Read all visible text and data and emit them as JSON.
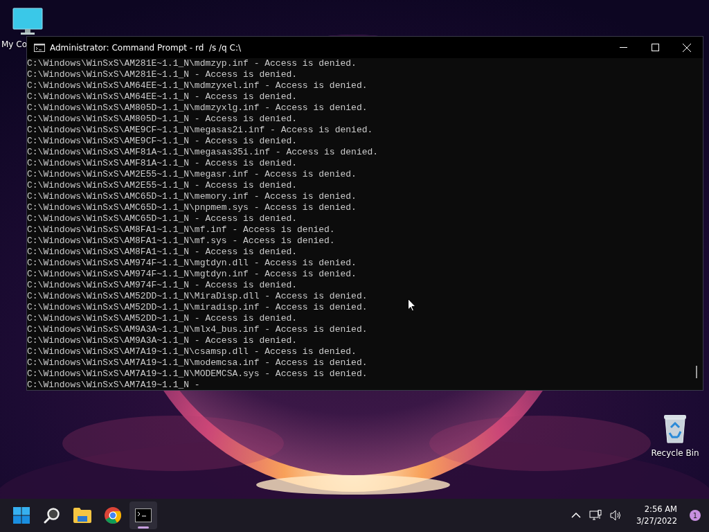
{
  "desktop_icons": [
    {
      "kind": "computer",
      "label": "My Co"
    },
    {
      "kind": "recycle",
      "label": "Recycle Bin"
    }
  ],
  "window": {
    "title": "Administrator: Command Prompt - rd  /s /q C:\\",
    "lines": [
      "C:\\Windows\\WinSxS\\AM281E~1.1_N\\mdmzyp.inf - Access is denied.",
      "C:\\Windows\\WinSxS\\AM281E~1.1_N - Access is denied.",
      "C:\\Windows\\WinSxS\\AM64EE~1.1_N\\mdmzyxel.inf - Access is denied.",
      "C:\\Windows\\WinSxS\\AM64EE~1.1_N - Access is denied.",
      "C:\\Windows\\WinSxS\\AM805D~1.1_N\\mdmzyxlg.inf - Access is denied.",
      "C:\\Windows\\WinSxS\\AM805D~1.1_N - Access is denied.",
      "C:\\Windows\\WinSxS\\AME9CF~1.1_N\\megasas2i.inf - Access is denied.",
      "C:\\Windows\\WinSxS\\AME9CF~1.1_N - Access is denied.",
      "C:\\Windows\\WinSxS\\AMF81A~1.1_N\\megasas35i.inf - Access is denied.",
      "C:\\Windows\\WinSxS\\AMF81A~1.1_N - Access is denied.",
      "C:\\Windows\\WinSxS\\AM2E55~1.1_N\\megasr.inf - Access is denied.",
      "C:\\Windows\\WinSxS\\AM2E55~1.1_N - Access is denied.",
      "C:\\Windows\\WinSxS\\AMC65D~1.1_N\\memory.inf - Access is denied.",
      "C:\\Windows\\WinSxS\\AMC65D~1.1_N\\pnpmem.sys - Access is denied.",
      "C:\\Windows\\WinSxS\\AMC65D~1.1_N - Access is denied.",
      "C:\\Windows\\WinSxS\\AM8FA1~1.1_N\\mf.inf - Access is denied.",
      "C:\\Windows\\WinSxS\\AM8FA1~1.1_N\\mf.sys - Access is denied.",
      "C:\\Windows\\WinSxS\\AM8FA1~1.1_N - Access is denied.",
      "C:\\Windows\\WinSxS\\AM974F~1.1_N\\mgtdyn.dll - Access is denied.",
      "C:\\Windows\\WinSxS\\AM974F~1.1_N\\mgtdyn.inf - Access is denied.",
      "C:\\Windows\\WinSxS\\AM974F~1.1_N - Access is denied.",
      "C:\\Windows\\WinSxS\\AM52DD~1.1_N\\MiraDisp.dll - Access is denied.",
      "C:\\Windows\\WinSxS\\AM52DD~1.1_N\\miradisp.inf - Access is denied.",
      "C:\\Windows\\WinSxS\\AM52DD~1.1_N - Access is denied.",
      "C:\\Windows\\WinSxS\\AM9A3A~1.1_N\\mlx4_bus.inf - Access is denied.",
      "C:\\Windows\\WinSxS\\AM9A3A~1.1_N - Access is denied.",
      "C:\\Windows\\WinSxS\\AM7A19~1.1_N\\csamsp.dll - Access is denied.",
      "C:\\Windows\\WinSxS\\AM7A19~1.1_N\\modemcsa.inf - Access is denied.",
      "C:\\Windows\\WinSxS\\AM7A19~1.1_N\\MODEMCSA.sys - Access is denied.",
      "C:\\Windows\\WinSxS\\AM7A19~1.1_N -"
    ]
  },
  "taskbar": {
    "apps": [
      {
        "kind": "start",
        "selected": false
      },
      {
        "kind": "search",
        "selected": false
      },
      {
        "kind": "files",
        "selected": false
      },
      {
        "kind": "browser",
        "selected": false
      },
      {
        "kind": "terminal",
        "selected": true
      }
    ],
    "time": "2:56 AM",
    "date": "3/27/2022",
    "notifications": "1"
  }
}
